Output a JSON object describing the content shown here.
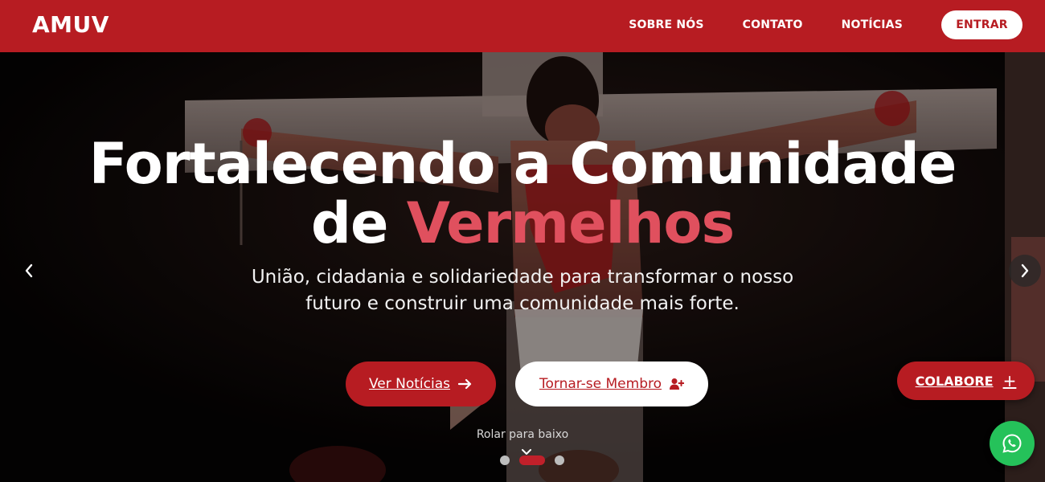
{
  "header": {
    "logo": "AMUV",
    "nav": [
      {
        "label": "SOBRE NÓS"
      },
      {
        "label": "CONTATO"
      },
      {
        "label": "NOTÍCIAS"
      }
    ],
    "login_label": "ENTRAR"
  },
  "hero": {
    "headline_line1": "Fortalecendo a Comunidade",
    "headline_line2_prefix": "de ",
    "headline_line2_accent": "Vermelhos",
    "subtitle_line1": "União, cidadania e solidariedade para transformar o nosso",
    "subtitle_line2": "futuro e construir uma comunidade mais forte.",
    "cta_news": "Ver Notícias",
    "cta_member": "Tornar-se Membro",
    "scroll_label": "Rolar para baixo",
    "carousel": {
      "slides": 3,
      "active_index": 1
    }
  },
  "floating": {
    "colabore_label": "COLABORE",
    "colabore_icon": "plus-icon",
    "whatsapp_icon": "whatsapp-icon"
  },
  "colors": {
    "brand_red": "#b71c22",
    "accent_pink": "#e0505e",
    "whatsapp_green": "#25c25a"
  }
}
